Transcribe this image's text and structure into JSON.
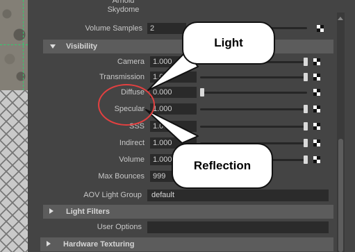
{
  "header": {
    "partial_label": "Arnold Skydome"
  },
  "volume_samples": {
    "label": "Volume Samples",
    "value": "2"
  },
  "visibility": {
    "title": "Visibility",
    "rows": [
      {
        "label": "Camera",
        "value": "1.000",
        "level": 1.0
      },
      {
        "label": "Transmission",
        "value": "1.000",
        "level": 1.0
      },
      {
        "label": "Diffuse",
        "value": "0.000",
        "level": 0.0
      },
      {
        "label": "Specular",
        "value": "1.000",
        "level": 1.0
      },
      {
        "label": "SSS",
        "value": "1.000",
        "level": 1.0
      },
      {
        "label": "Indirect",
        "value": "1.000",
        "level": 1.0
      },
      {
        "label": "Volume",
        "value": "1.000",
        "level": 1.0
      }
    ],
    "max_bounces": {
      "label": "Max Bounces",
      "value": "999"
    }
  },
  "aov": {
    "label": "AOV Light Group",
    "value": "default"
  },
  "light_filters": {
    "title": "Light Filters"
  },
  "user_options": {
    "label": "User Options",
    "value": ""
  },
  "hardware_texturing": {
    "title": "Hardware Texturing"
  },
  "callouts": {
    "top": "Light",
    "bottom": "Reflection"
  }
}
